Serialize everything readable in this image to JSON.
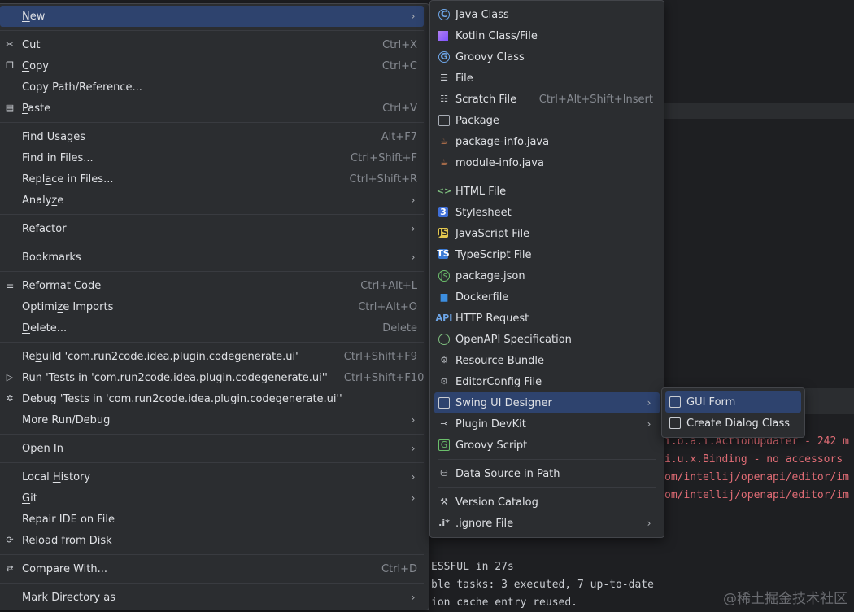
{
  "main_menu": [
    {
      "type": "item",
      "id": "new",
      "label": "New",
      "ul": "N",
      "arrow": true,
      "active": true,
      "icon": ""
    },
    {
      "type": "sep"
    },
    {
      "type": "item",
      "id": "cut",
      "label": "Cut",
      "ul": "t",
      "shortcut": "Ctrl+X",
      "icon": "scissors-icon",
      "glyph": "✂"
    },
    {
      "type": "item",
      "id": "copy",
      "label": "Copy",
      "ul": "C",
      "shortcut": "Ctrl+C",
      "icon": "copy-icon",
      "glyph": "❐"
    },
    {
      "type": "item",
      "id": "copy-path",
      "label": "Copy Path/Reference...",
      "shortcut": "",
      "icon": ""
    },
    {
      "type": "item",
      "id": "paste",
      "label": "Paste",
      "ul": "P",
      "shortcut": "Ctrl+V",
      "icon": "paste-icon",
      "glyph": "▤"
    },
    {
      "type": "sep"
    },
    {
      "type": "item",
      "id": "find-usages",
      "label": "Find Usages",
      "ul": "U",
      "shortcut": "Alt+F7",
      "icon": ""
    },
    {
      "type": "item",
      "id": "find-in-files",
      "label": "Find in Files...",
      "shortcut": "Ctrl+Shift+F",
      "icon": ""
    },
    {
      "type": "item",
      "id": "replace-in-files",
      "label": "Replace in Files...",
      "ul": "a",
      "shortcut": "Ctrl+Shift+R",
      "icon": ""
    },
    {
      "type": "item",
      "id": "analyze",
      "label": "Analyze",
      "ul": "z",
      "arrow": true,
      "icon": ""
    },
    {
      "type": "sep"
    },
    {
      "type": "item",
      "id": "refactor",
      "label": "Refactor",
      "ul": "R",
      "arrow": true,
      "icon": ""
    },
    {
      "type": "sep"
    },
    {
      "type": "item",
      "id": "bookmarks",
      "label": "Bookmarks",
      "arrow": true,
      "icon": ""
    },
    {
      "type": "sep"
    },
    {
      "type": "item",
      "id": "reformat-code",
      "label": "Reformat Code",
      "ul": "R",
      "shortcut": "Ctrl+Alt+L",
      "icon": "reformat-icon",
      "glyph": "☰"
    },
    {
      "type": "item",
      "id": "optimize-imports",
      "label": "Optimize Imports",
      "ul": "z",
      "shortcut": "Ctrl+Alt+O",
      "icon": ""
    },
    {
      "type": "item",
      "id": "delete",
      "label": "Delete...",
      "ul": "D",
      "shortcut": "Delete",
      "icon": ""
    },
    {
      "type": "sep"
    },
    {
      "type": "item",
      "id": "rebuild",
      "label": "Rebuild 'com.run2code.idea.plugin.codegenerate.ui'",
      "ul": "b",
      "shortcut": "Ctrl+Shift+F9",
      "icon": ""
    },
    {
      "type": "item",
      "id": "run-tests",
      "label": "Run 'Tests in 'com.run2code.idea.plugin.codegenerate.ui''",
      "ul": "u",
      "shortcut": "Ctrl+Shift+F10",
      "icon": "run-icon",
      "glyph": "▷"
    },
    {
      "type": "item",
      "id": "debug-tests",
      "label": "Debug 'Tests in 'com.run2code.idea.plugin.codegenerate.ui''",
      "ul": "D",
      "shortcut": "",
      "icon": "debug-icon",
      "glyph": "✲"
    },
    {
      "type": "item",
      "id": "more-run-debug",
      "label": "More Run/Debug",
      "arrow": true,
      "icon": ""
    },
    {
      "type": "sep"
    },
    {
      "type": "item",
      "id": "open-in",
      "label": "Open In",
      "arrow": true,
      "icon": ""
    },
    {
      "type": "sep"
    },
    {
      "type": "item",
      "id": "local-history",
      "label": "Local History",
      "ul": "H",
      "arrow": true,
      "icon": ""
    },
    {
      "type": "item",
      "id": "git",
      "label": "Git",
      "ul": "G",
      "arrow": true,
      "icon": ""
    },
    {
      "type": "item",
      "id": "repair-ide",
      "label": "Repair IDE on File",
      "icon": ""
    },
    {
      "type": "item",
      "id": "reload-from-disk",
      "label": "Reload from Disk",
      "icon": "reload-icon",
      "glyph": "⟳"
    },
    {
      "type": "sep"
    },
    {
      "type": "item",
      "id": "compare-with",
      "label": "Compare With...",
      "shortcut": "Ctrl+D",
      "icon": "compare-icon",
      "glyph": "⇄"
    },
    {
      "type": "sep"
    },
    {
      "type": "item",
      "id": "mark-directory-as",
      "label": "Mark Directory as",
      "arrow": true,
      "icon": ""
    }
  ],
  "new_menu": [
    {
      "type": "item",
      "id": "java-class",
      "label": "Java Class",
      "icon": "java-class-icon",
      "cls": "ic-circle",
      "glyph": "C"
    },
    {
      "type": "item",
      "id": "kotlin-class",
      "label": "Kotlin Class/File",
      "icon": "kotlin-icon",
      "cls": "ic-kotlin",
      "glyph": ""
    },
    {
      "type": "item",
      "id": "groovy-class",
      "label": "Groovy Class",
      "icon": "groovy-class-icon",
      "cls": "ic-circle",
      "glyph": "G"
    },
    {
      "type": "item",
      "id": "file",
      "label": "File",
      "icon": "file-icon",
      "cls": "ic-lines",
      "glyph": "☰"
    },
    {
      "type": "item",
      "id": "scratch-file",
      "label": "Scratch File",
      "shortcut": "Ctrl+Alt+Shift+Insert",
      "icon": "scratch-file-icon",
      "cls": "ic-lines",
      "glyph": "☷"
    },
    {
      "type": "item",
      "id": "package",
      "label": "Package",
      "icon": "package-icon",
      "cls": "ic-box",
      "glyph": ""
    },
    {
      "type": "item",
      "id": "package-info",
      "label": "package-info.java",
      "icon": "java-file-icon",
      "cls": "ic-java",
      "glyph": "☕"
    },
    {
      "type": "item",
      "id": "module-info",
      "label": "module-info.java",
      "icon": "java-file-icon",
      "cls": "ic-java",
      "glyph": "☕"
    },
    {
      "type": "sep"
    },
    {
      "type": "item",
      "id": "html-file",
      "label": "HTML File",
      "icon": "html-icon",
      "cls": "ic-html",
      "glyph": "<>"
    },
    {
      "type": "item",
      "id": "stylesheet",
      "label": "Stylesheet",
      "icon": "css-icon",
      "cls": "ic-css",
      "glyph": "3"
    },
    {
      "type": "item",
      "id": "javascript-file",
      "label": "JavaScript File",
      "icon": "javascript-icon",
      "cls": "ic-js",
      "glyph": "JS"
    },
    {
      "type": "item",
      "id": "typescript-file",
      "label": "TypeScript File",
      "icon": "typescript-icon",
      "cls": "ic-ts",
      "glyph": "TS"
    },
    {
      "type": "item",
      "id": "package-json",
      "label": "package.json",
      "icon": "nodejs-icon",
      "cls": "ic-json",
      "glyph": "js"
    },
    {
      "type": "item",
      "id": "dockerfile",
      "label": "Dockerfile",
      "icon": "docker-icon",
      "cls": "ic-docker",
      "glyph": "▆"
    },
    {
      "type": "item",
      "id": "http-request",
      "label": "HTTP Request",
      "icon": "api-icon",
      "cls": "ic-api",
      "glyph": "API"
    },
    {
      "type": "item",
      "id": "openapi-spec",
      "label": "OpenAPI Specification",
      "icon": "openapi-icon",
      "cls": "ic-openapi",
      "glyph": ""
    },
    {
      "type": "item",
      "id": "resource-bundle",
      "label": "Resource Bundle",
      "icon": "resource-bundle-icon",
      "cls": "ic-gear",
      "glyph": "⚙"
    },
    {
      "type": "item",
      "id": "editorconfig-file",
      "label": "EditorConfig File",
      "icon": "editorconfig-icon",
      "cls": "ic-gear",
      "glyph": "⚙"
    },
    {
      "type": "item",
      "id": "swing-ui-designer",
      "label": "Swing UI Designer",
      "arrow": true,
      "active": true,
      "icon": "window-icon",
      "cls": "ic-window",
      "glyph": ""
    },
    {
      "type": "item",
      "id": "plugin-devkit",
      "label": "Plugin DevKit",
      "arrow": true,
      "icon": "plugin-icon",
      "cls": "ic-plug",
      "glyph": "⊸"
    },
    {
      "type": "item",
      "id": "groovy-script",
      "label": "Groovy Script",
      "icon": "groovy-script-icon",
      "cls": "ic-groovy",
      "glyph": "G"
    },
    {
      "type": "sep"
    },
    {
      "type": "item",
      "id": "data-source-in-path",
      "label": "Data Source in Path",
      "icon": "database-icon",
      "cls": "ic-db",
      "glyph": "⛁"
    },
    {
      "type": "sep"
    },
    {
      "type": "item",
      "id": "version-catalog",
      "label": "Version Catalog",
      "icon": "catalog-icon",
      "cls": "ic-catalog",
      "glyph": "⚒"
    },
    {
      "type": "item",
      "id": "ignore-file",
      "label": ".ignore File",
      "arrow": true,
      "icon": "ignore-icon",
      "cls": "ic-ignore",
      "glyph": ".i*"
    }
  ],
  "swing_menu": [
    {
      "type": "item",
      "id": "gui-form",
      "label": "GUI Form",
      "active": true,
      "icon": "window-icon",
      "cls": "ic-window",
      "glyph": ""
    },
    {
      "type": "item",
      "id": "create-dialog-class",
      "label": "Create Dialog Class",
      "icon": "window-icon",
      "cls": "ic-window",
      "glyph": ""
    }
  ],
  "console": {
    "lines_right": [
      "i.o.a.i.ActionUpdater - 242 m",
      "i.u.x.Binding - no accessors",
      "om/intellij/openapi/editor/im",
      "om/intellij/openapi/editor/im"
    ],
    "lines_bottom": [
      "ESSFUL in 27s",
      "ble tasks: 3 executed, 7 up-to-date",
      "ion cache entry reused."
    ]
  },
  "watermark": "@稀土掘金技术社区"
}
